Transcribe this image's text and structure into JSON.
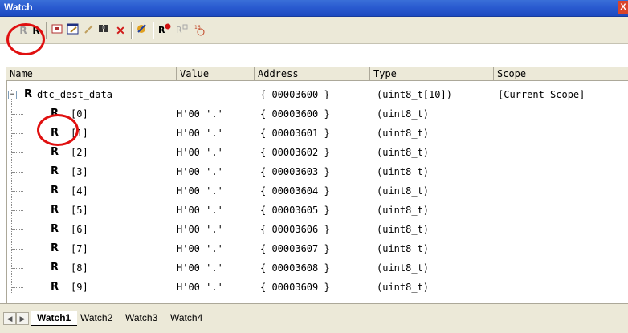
{
  "window": {
    "title": "Watch",
    "close_glyph": "X"
  },
  "toolbar": {
    "icons": [
      "refresh-gray-icon",
      "refresh-icon",
      "add-watch-icon",
      "edit-watch-icon",
      "pencil-icon",
      "find-icon",
      "delete-icon",
      "radix-icon",
      "breakpoint-icon",
      "watch-item-icon",
      "format-icon"
    ]
  },
  "columns": [
    "Name",
    "Value",
    "Address",
    "Type",
    "Scope"
  ],
  "root": {
    "name": "dtc_dest_data",
    "address": "{ 00003600 }",
    "type": "(uint8_t[10])",
    "scope": "[Current Scope]",
    "marker": "R"
  },
  "children": [
    {
      "name": "[0]",
      "value": "H'00 '.'",
      "address": "{ 00003600 }",
      "type": "(uint8_t)",
      "marker": "R"
    },
    {
      "name": "[1]",
      "value": "H'00 '.'",
      "address": "{ 00003601 }",
      "type": "(uint8_t)",
      "marker": "R"
    },
    {
      "name": "[2]",
      "value": "H'00 '.'",
      "address": "{ 00003602 }",
      "type": "(uint8_t)",
      "marker": "R"
    },
    {
      "name": "[3]",
      "value": "H'00 '.'",
      "address": "{ 00003603 }",
      "type": "(uint8_t)",
      "marker": "R"
    },
    {
      "name": "[4]",
      "value": "H'00 '.'",
      "address": "{ 00003604 }",
      "type": "(uint8_t)",
      "marker": "R"
    },
    {
      "name": "[5]",
      "value": "H'00 '.'",
      "address": "{ 00003605 }",
      "type": "(uint8_t)",
      "marker": "R"
    },
    {
      "name": "[6]",
      "value": "H'00 '.'",
      "address": "{ 00003606 }",
      "type": "(uint8_t)",
      "marker": "R"
    },
    {
      "name": "[7]",
      "value": "H'00 '.'",
      "address": "{ 00003607 }",
      "type": "(uint8_t)",
      "marker": "R"
    },
    {
      "name": "[8]",
      "value": "H'00 '.'",
      "address": "{ 00003608 }",
      "type": "(uint8_t)",
      "marker": "R"
    },
    {
      "name": "[9]",
      "value": "H'00 '.'",
      "address": "{ 00003609 }",
      "type": "(uint8_t)",
      "marker": "R"
    }
  ],
  "tabs": [
    "Watch1",
    "Watch2",
    "Watch3",
    "Watch4"
  ],
  "active_tab": "Watch1",
  "colors": {
    "titlebar": "#2a5bd0",
    "highlight_circle": "#e01010",
    "panel": "#ece9d8"
  }
}
